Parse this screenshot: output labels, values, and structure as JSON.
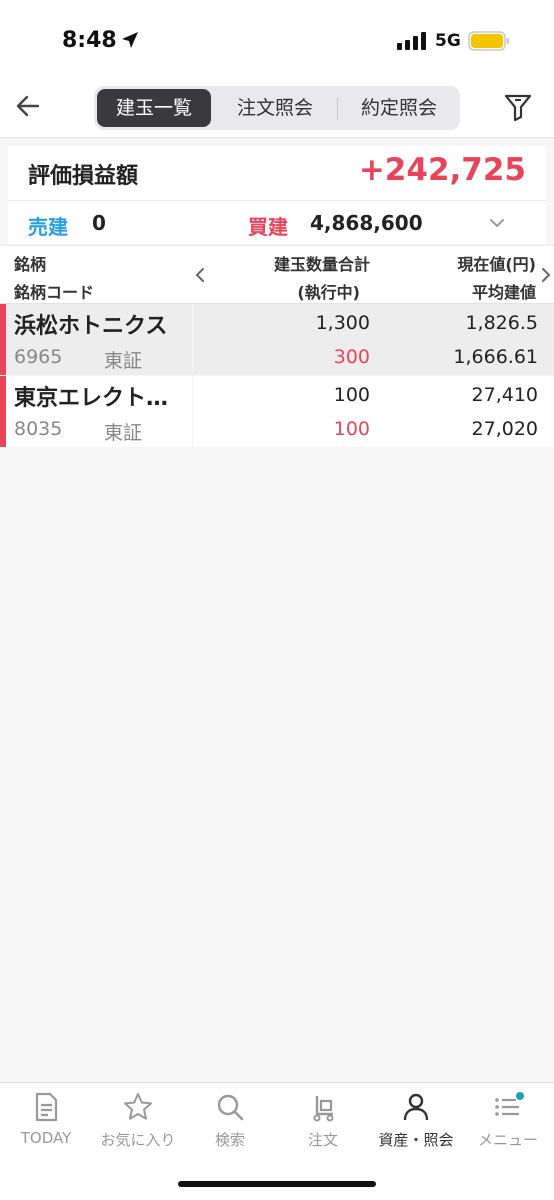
{
  "status_bar": {
    "time": "8:48",
    "network": "5G"
  },
  "nav": {
    "tabs": [
      {
        "label": "建玉一覧",
        "active": true
      },
      {
        "label": "注文照会",
        "active": false
      },
      {
        "label": "約定照会",
        "active": false
      }
    ]
  },
  "summary": {
    "label": "評価損益額",
    "value": "+242,725"
  },
  "long_short": {
    "sell_label": "売建",
    "sell_value": "0",
    "buy_label": "買建",
    "buy_value": "4,868,600"
  },
  "table": {
    "headers": {
      "col1_line1": "銘柄",
      "col1_line2": "銘柄コード",
      "col2_line1": "建玉数量合計",
      "col2_line2": "(執行中)",
      "col3_line1": "現在値(円)",
      "col3_line2": "平均建値"
    },
    "rows": [
      {
        "name": "浜松ホトニクス",
        "code": "6965",
        "market": "東証",
        "quantity": "1,300",
        "executing": "300",
        "current_price": "1,826.5",
        "avg_price": "1,666.61"
      },
      {
        "name": "東京エレクト…",
        "code": "8035",
        "market": "東証",
        "quantity": "100",
        "executing": "100",
        "current_price": "27,410",
        "avg_price": "27,020"
      }
    ]
  },
  "tabbar": {
    "items": [
      {
        "label": "TODAY",
        "icon": "document-icon"
      },
      {
        "label": "お気に入り",
        "icon": "star-icon"
      },
      {
        "label": "検索",
        "icon": "search-icon"
      },
      {
        "label": "注文",
        "icon": "cart-icon"
      },
      {
        "label": "資産・照会",
        "icon": "person-icon"
      },
      {
        "label": "メニュー",
        "icon": "menu-icon"
      }
    ],
    "active_index": 4
  },
  "colors": {
    "accent_red": "#e8445a",
    "accent_blue": "#2a9fe0",
    "battery": "#f5c400",
    "notification_dot": "#1aa0b8"
  }
}
